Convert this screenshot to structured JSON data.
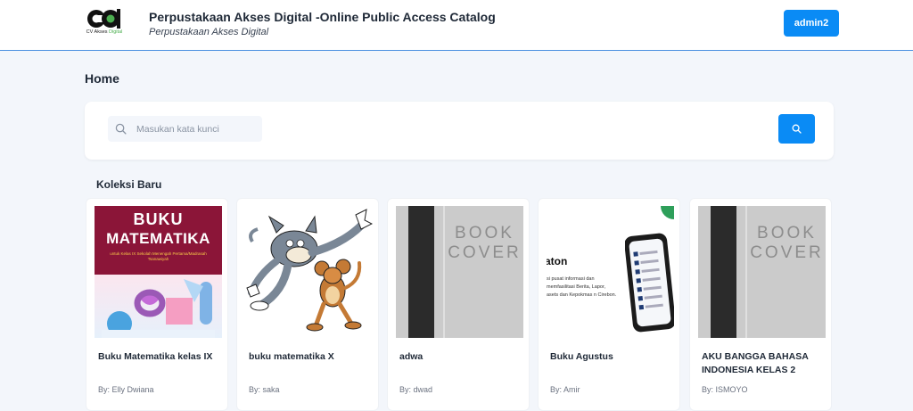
{
  "header": {
    "logo_text_main": "CV Akses ",
    "logo_text_accent": "Digital",
    "title": "Perpustakaan Akses Digital -Online Public Access Catalog",
    "subtitle": "Perpustakaan Akses Digital",
    "user_label": "admin2"
  },
  "page": {
    "title": "Home"
  },
  "search": {
    "placeholder": "Masukan kata kunci",
    "icon": "search-icon"
  },
  "collection": {
    "title": "Koleksi Baru",
    "books": [
      {
        "title": "Buku Matematika kelas IX",
        "author": "By: Elly Dwiana",
        "cover": {
          "line1": "BUKU",
          "line2": "MATEMATIKA",
          "line3": "untuk Kelas IX Sekolah Menengah Pertama/Madrasah Tsanawiyah"
        }
      },
      {
        "title": "buku matematika X",
        "author": "By: saka"
      },
      {
        "title": "adwa",
        "author": "By: dwad",
        "cover": {
          "word1": "BOOK",
          "word2": "COVER"
        }
      },
      {
        "title": "Buku Agustus",
        "author": "By: Amir",
        "cover": {
          "heading": "aton",
          "text": "si pusat informasi dan memfasilitasi Berita, Lapor, asets dan Kepokmas n Cirebon."
        }
      },
      {
        "title": "AKU BANGGA BAHASA INDONESIA KELAS 2",
        "author": "By: ISMOYO",
        "cover": {
          "word1": "BOOK",
          "word2": "COVER"
        }
      }
    ]
  },
  "colors": {
    "primary": "#0a8bf5",
    "background": "#f3f6fb"
  }
}
